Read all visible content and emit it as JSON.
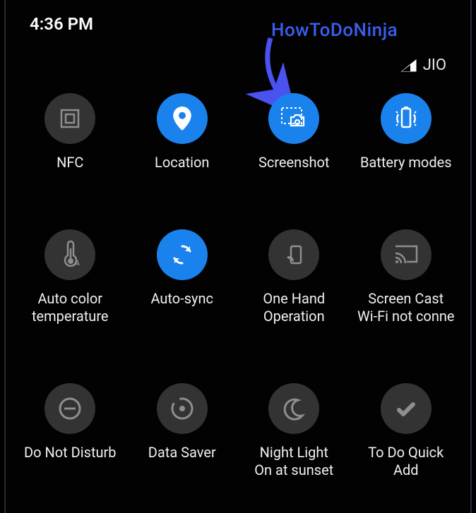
{
  "status": {
    "time": "4:36 PM",
    "carrier": "JIO"
  },
  "watermark": "HowToDoNinja",
  "tiles": {
    "nfc": {
      "label": "NFC",
      "sub": "",
      "active": false
    },
    "location": {
      "label": "Location",
      "sub": "",
      "active": true
    },
    "screenshot": {
      "label": "Screenshot",
      "sub": "",
      "active": true
    },
    "battery": {
      "label": "Battery modes",
      "sub": "",
      "active": true
    },
    "autocolor": {
      "label": "Auto color",
      "sub": "temperature",
      "active": false
    },
    "autosync": {
      "label": "Auto-sync",
      "sub": "",
      "active": true
    },
    "onehand": {
      "label": "One Hand",
      "sub": "Operation",
      "active": false
    },
    "cast": {
      "label": "Screen Cast",
      "sub": "Wi-Fi not conne",
      "active": false
    },
    "dnd": {
      "label": "Do Not Disturb",
      "sub": "",
      "active": false
    },
    "datasaver": {
      "label": "Data Saver",
      "sub": "",
      "active": false
    },
    "nightlight": {
      "label": "Night Light",
      "sub": "On at sunset",
      "active": false
    },
    "todo": {
      "label": "To Do Quick",
      "sub": "Add",
      "active": false
    }
  }
}
